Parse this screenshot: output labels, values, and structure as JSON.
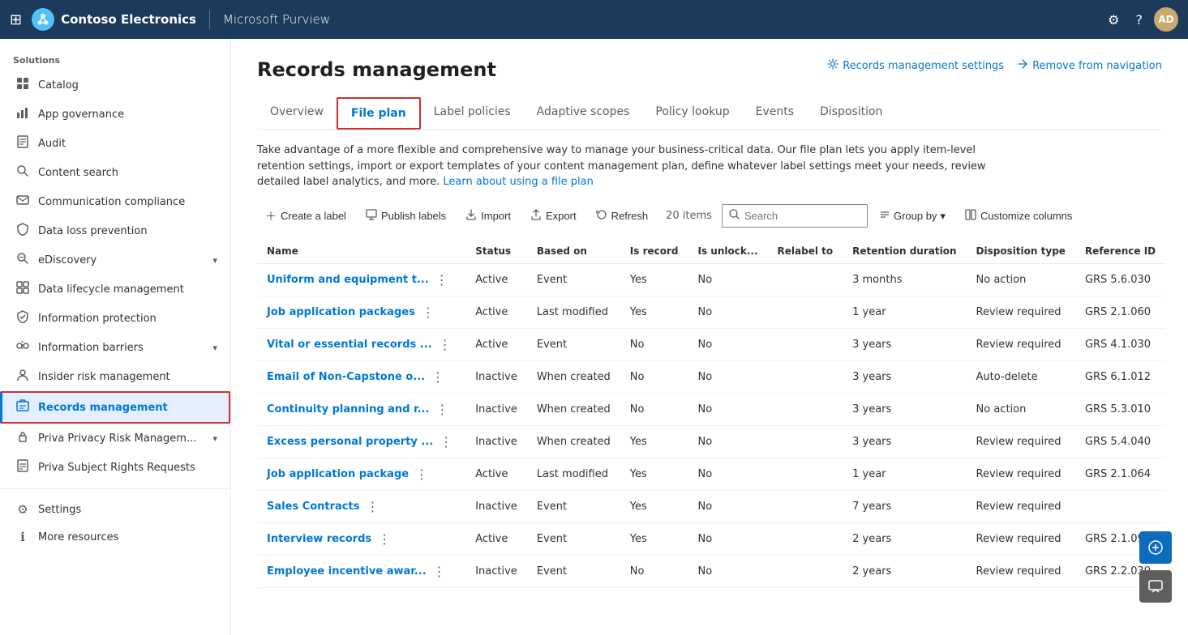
{
  "topNav": {
    "waffle": "⊞",
    "orgName": "Contoso Electronics",
    "appName": "Microsoft Purview",
    "settingsIcon": "⚙",
    "helpIcon": "?",
    "avatarText": "AD"
  },
  "sidebar": {
    "sectionLabel": "Solutions",
    "items": [
      {
        "id": "catalog",
        "label": "Catalog",
        "icon": "🗂",
        "active": false,
        "hasChevron": false
      },
      {
        "id": "app-governance",
        "label": "App governance",
        "icon": "📊",
        "active": false,
        "hasChevron": false
      },
      {
        "id": "audit",
        "label": "Audit",
        "icon": "📋",
        "active": false,
        "hasChevron": false
      },
      {
        "id": "content-search",
        "label": "Content search",
        "icon": "🔍",
        "active": false,
        "hasChevron": false
      },
      {
        "id": "communication-compliance",
        "label": "Communication compliance",
        "icon": "💬",
        "active": false,
        "hasChevron": false
      },
      {
        "id": "data-loss-prevention",
        "label": "Data loss prevention",
        "icon": "🛡",
        "active": false,
        "hasChevron": false
      },
      {
        "id": "ediscovery",
        "label": "eDiscovery",
        "icon": "🔎",
        "active": false,
        "hasChevron": true
      },
      {
        "id": "data-lifecycle",
        "label": "Data lifecycle management",
        "icon": "🔄",
        "active": false,
        "hasChevron": false
      },
      {
        "id": "information-protection",
        "label": "Information protection",
        "icon": "🔒",
        "active": false,
        "hasChevron": false
      },
      {
        "id": "information-barriers",
        "label": "Information barriers",
        "icon": "🚧",
        "active": false,
        "hasChevron": true
      },
      {
        "id": "insider-risk",
        "label": "Insider risk management",
        "icon": "⚠",
        "active": false,
        "hasChevron": false
      },
      {
        "id": "records-management",
        "label": "Records management",
        "icon": "📁",
        "active": true,
        "hasChevron": false
      },
      {
        "id": "priva-privacy",
        "label": "Priva Privacy Risk Managem...",
        "icon": "🔐",
        "active": false,
        "hasChevron": true
      },
      {
        "id": "priva-subject",
        "label": "Priva Subject Rights Requests",
        "icon": "📄",
        "active": false,
        "hasChevron": false
      }
    ],
    "bottomItems": [
      {
        "id": "settings",
        "label": "Settings",
        "icon": "⚙"
      },
      {
        "id": "more-resources",
        "label": "More resources",
        "icon": "ℹ"
      }
    ]
  },
  "page": {
    "title": "Records management",
    "settingsLinkLabel": "Records management settings",
    "removeNavLabel": "Remove from navigation"
  },
  "tabs": [
    {
      "id": "overview",
      "label": "Overview",
      "active": false
    },
    {
      "id": "file-plan",
      "label": "File plan",
      "active": true
    },
    {
      "id": "label-policies",
      "label": "Label policies",
      "active": false
    },
    {
      "id": "adaptive-scopes",
      "label": "Adaptive scopes",
      "active": false
    },
    {
      "id": "policy-lookup",
      "label": "Policy lookup",
      "active": false
    },
    {
      "id": "events",
      "label": "Events",
      "active": false
    },
    {
      "id": "disposition",
      "label": "Disposition",
      "active": false
    }
  ],
  "description": {
    "text": "Take advantage of a more flexible and comprehensive way to manage your business-critical data. Our file plan lets you apply item-level retention settings, import or export templates of your content management plan, define whatever label settings meet your needs, review detailed label analytics, and more.",
    "linkText": "Learn about using a file plan"
  },
  "toolbar": {
    "createLabel": "Create a label",
    "publishLabel": "Publish labels",
    "importLabel": "Import",
    "exportLabel": "Export",
    "refreshLabel": "Refresh",
    "itemsCount": "20 items",
    "searchPlaceholder": "Search",
    "groupByLabel": "Group by",
    "customizeLabel": "Customize columns"
  },
  "table": {
    "columns": [
      {
        "id": "name",
        "label": "Name"
      },
      {
        "id": "status",
        "label": "Status"
      },
      {
        "id": "based-on",
        "label": "Based on"
      },
      {
        "id": "is-record",
        "label": "Is record"
      },
      {
        "id": "is-unlock",
        "label": "Is unlock..."
      },
      {
        "id": "relabel-to",
        "label": "Relabel to"
      },
      {
        "id": "retention-duration",
        "label": "Retention duration"
      },
      {
        "id": "disposition-type",
        "label": "Disposition type"
      },
      {
        "id": "reference-id",
        "label": "Reference ID"
      }
    ],
    "rows": [
      {
        "name": "Uniform and equipment t...",
        "status": "Active",
        "basedOn": "Event",
        "isRecord": "Yes",
        "isUnlock": "No",
        "relabelTo": "",
        "retentionDuration": "3 months",
        "dispositionType": "No action",
        "referenceId": "GRS 5.6.030"
      },
      {
        "name": "Job application packages",
        "status": "Active",
        "basedOn": "Last modified",
        "isRecord": "Yes",
        "isUnlock": "No",
        "relabelTo": "",
        "retentionDuration": "1 year",
        "dispositionType": "Review required",
        "referenceId": "GRS 2.1.060"
      },
      {
        "name": "Vital or essential records ...",
        "status": "Active",
        "basedOn": "Event",
        "isRecord": "No",
        "isUnlock": "No",
        "relabelTo": "",
        "retentionDuration": "3 years",
        "dispositionType": "Review required",
        "referenceId": "GRS 4.1.030"
      },
      {
        "name": "Email of Non-Capstone o...",
        "status": "Inactive",
        "basedOn": "When created",
        "isRecord": "No",
        "isUnlock": "No",
        "relabelTo": "",
        "retentionDuration": "3 years",
        "dispositionType": "Auto-delete",
        "referenceId": "GRS 6.1.012"
      },
      {
        "name": "Continuity planning and r...",
        "status": "Inactive",
        "basedOn": "When created",
        "isRecord": "No",
        "isUnlock": "No",
        "relabelTo": "",
        "retentionDuration": "3 years",
        "dispositionType": "No action",
        "referenceId": "GRS 5.3.010"
      },
      {
        "name": "Excess personal property ...",
        "status": "Inactive",
        "basedOn": "When created",
        "isRecord": "Yes",
        "isUnlock": "No",
        "relabelTo": "",
        "retentionDuration": "3 years",
        "dispositionType": "Review required",
        "referenceId": "GRS 5.4.040"
      },
      {
        "name": "Job application package",
        "status": "Active",
        "basedOn": "Last modified",
        "isRecord": "Yes",
        "isUnlock": "No",
        "relabelTo": "",
        "retentionDuration": "1 year",
        "dispositionType": "Review required",
        "referenceId": "GRS 2.1.064"
      },
      {
        "name": "Sales Contracts",
        "status": "Inactive",
        "basedOn": "Event",
        "isRecord": "Yes",
        "isUnlock": "No",
        "relabelTo": "",
        "retentionDuration": "7 years",
        "dispositionType": "Review required",
        "referenceId": ""
      },
      {
        "name": "Interview records",
        "status": "Active",
        "basedOn": "Event",
        "isRecord": "Yes",
        "isUnlock": "No",
        "relabelTo": "",
        "retentionDuration": "2 years",
        "dispositionType": "Review required",
        "referenceId": "GRS 2.1.090"
      },
      {
        "name": "Employee incentive awar...",
        "status": "Inactive",
        "basedOn": "Event",
        "isRecord": "No",
        "isUnlock": "No",
        "relabelTo": "",
        "retentionDuration": "2 years",
        "dispositionType": "Review required",
        "referenceId": "GRS 2.2.030"
      }
    ]
  }
}
